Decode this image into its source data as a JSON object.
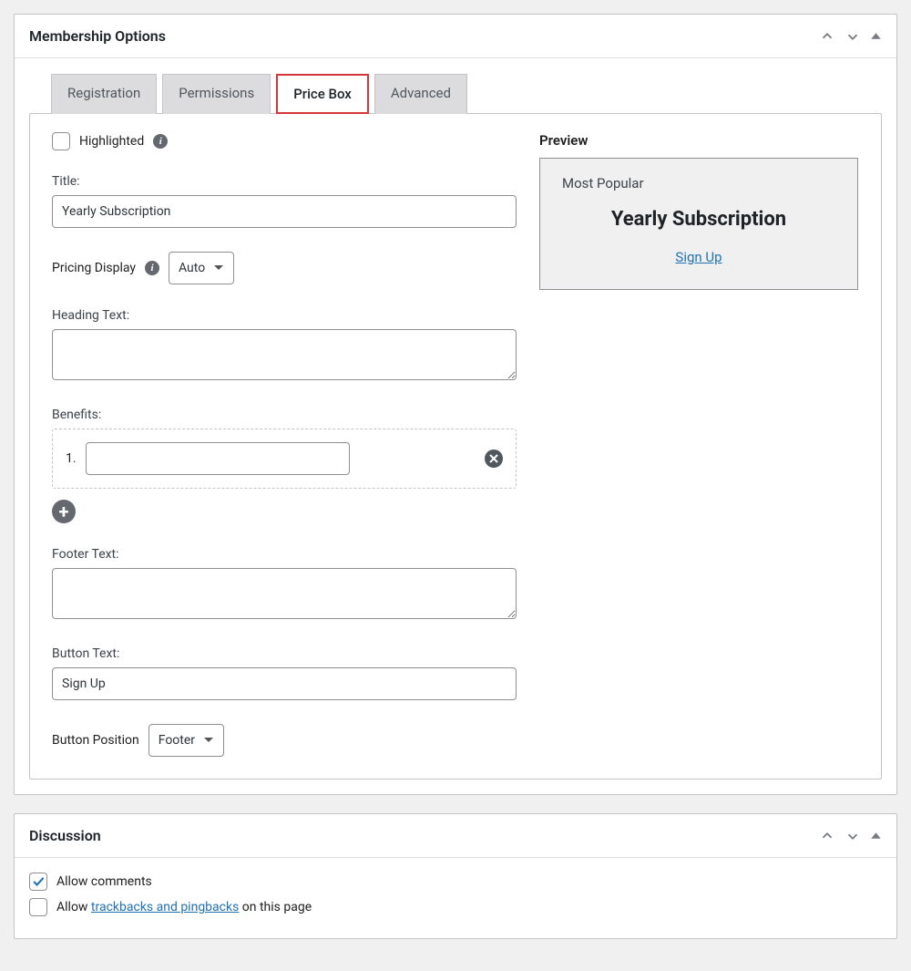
{
  "membership": {
    "panel_title": "Membership Options",
    "tabs": [
      "Registration",
      "Permissions",
      "Price Box",
      "Advanced"
    ],
    "highlighted": {
      "label": "Highlighted",
      "checked": false
    },
    "title": {
      "label": "Title:",
      "value": "Yearly Subscription"
    },
    "pricing_display": {
      "label": "Pricing Display",
      "value": "Auto"
    },
    "heading_text": {
      "label": "Heading Text:",
      "value": ""
    },
    "benefits": {
      "label": "Benefits:",
      "item_number": "1.",
      "value": ""
    },
    "footer_text": {
      "label": "Footer Text:",
      "value": ""
    },
    "button_text": {
      "label": "Button Text:",
      "value": "Sign Up"
    },
    "button_position": {
      "label": "Button Position",
      "value": "Footer"
    },
    "preview": {
      "label": "Preview",
      "tag": "Most Popular",
      "title": "Yearly Subscription",
      "button": "Sign Up"
    }
  },
  "discussion": {
    "panel_title": "Discussion",
    "comments": {
      "checked": true,
      "label": "Allow comments"
    },
    "pings": {
      "checked": false,
      "before": "Allow ",
      "link": "trackbacks and pingbacks",
      "after": " on this page"
    }
  }
}
